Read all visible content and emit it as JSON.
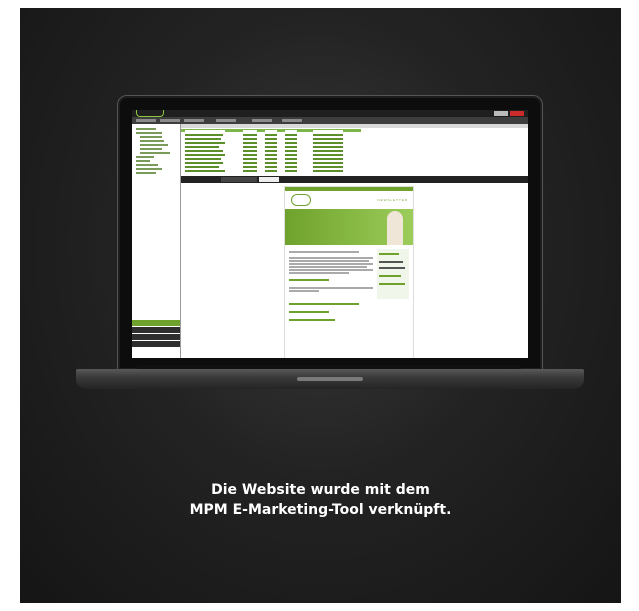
{
  "caption": {
    "line1": "Die Website wurde mit dem",
    "line2": "MPM E-Marketing-Tool verknüpft."
  },
  "screen": {
    "newsletter_word": "NEWSLETTER"
  },
  "colors": {
    "accent": "#6fa22c",
    "panel_background": "#232323",
    "danger": "#cc2b2b"
  }
}
